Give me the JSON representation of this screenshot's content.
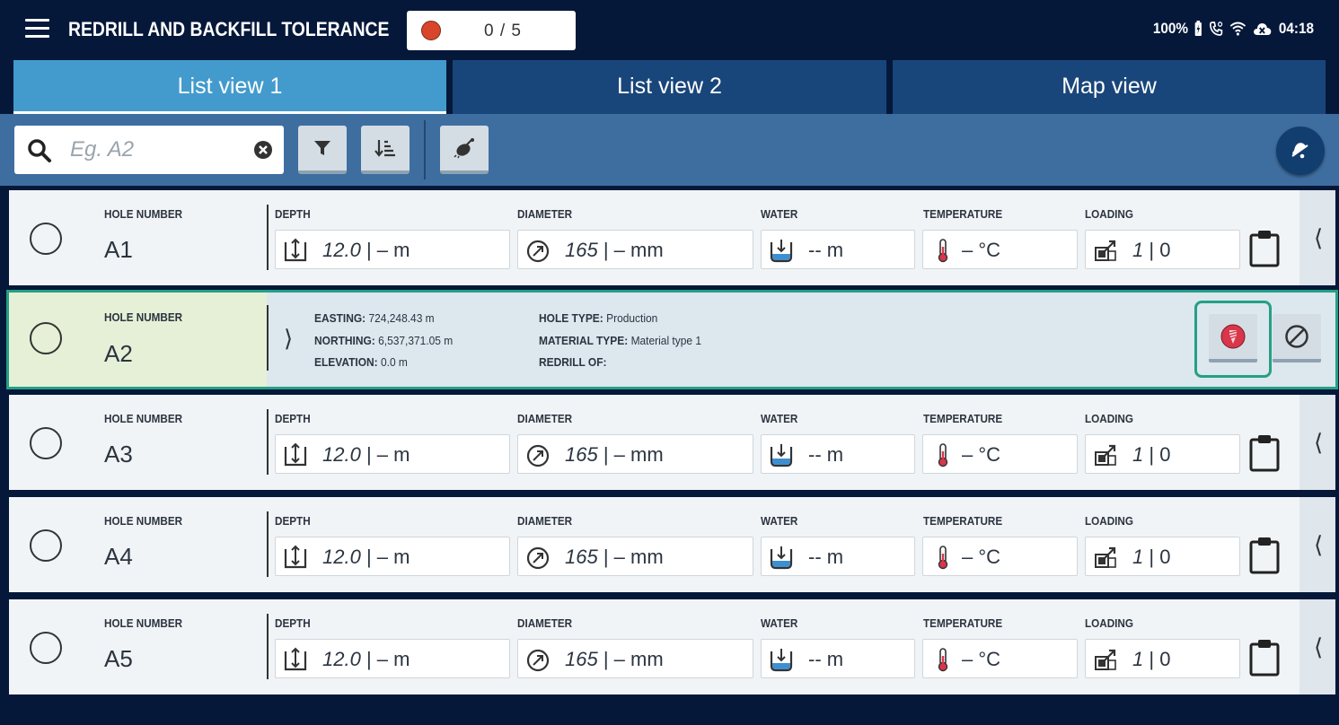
{
  "header": {
    "title": "REDRILL AND BACKFILL TOLERANCE",
    "progress": "0 / 5",
    "status_color": "#d8452b"
  },
  "status_bar": {
    "battery": "100%",
    "time": "04:18",
    "icons": [
      "battery-charging-icon",
      "phone-icon",
      "wifi-icon",
      "cloud-off-icon"
    ]
  },
  "tabs": [
    {
      "label": "List view 1",
      "active": true
    },
    {
      "label": "List view 2",
      "active": false
    },
    {
      "label": "Map view",
      "active": false
    }
  ],
  "toolbar": {
    "search_placeholder": "Eg. A2",
    "buttons": [
      "filter-icon",
      "sort-icon",
      "satellite-icon"
    ],
    "notification": "bell-icon"
  },
  "labels": {
    "hole_number": "HOLE NUMBER",
    "depth": "DEPTH",
    "diameter": "DIAMETER",
    "water": "WATER",
    "temperature": "TEMPERATURE",
    "loading": "LOADING"
  },
  "rows": [
    {
      "hole": "A1",
      "depth_val": "12.0",
      "depth_rest": " |  –  m",
      "diam_val": "165",
      "diam_rest": " |  –  mm",
      "water": "-- m",
      "temp": "– °C",
      "load_val": "1",
      "load_rest": " | 0"
    },
    {
      "hole": "A3",
      "depth_val": "12.0",
      "depth_rest": " |  –  m",
      "diam_val": "165",
      "diam_rest": " |  –  mm",
      "water": "-- m",
      "temp": "– °C",
      "load_val": "1",
      "load_rest": " | 0"
    },
    {
      "hole": "A4",
      "depth_val": "12.0",
      "depth_rest": " |  –  m",
      "diam_val": "165",
      "diam_rest": " |  –  mm",
      "water": "-- m",
      "temp": "– °C",
      "load_val": "1",
      "load_rest": " | 0"
    },
    {
      "hole": "A5",
      "depth_val": "12.0",
      "depth_rest": " |  –  m",
      "diam_val": "165",
      "diam_rest": " |  –  mm",
      "water": "-- m",
      "temp": "– °C",
      "load_val": "1",
      "load_rest": " | 0"
    }
  ],
  "expanded_row": {
    "hole": "A2",
    "easting_label": "EASTING:",
    "easting": "724,248.43 m",
    "northing_label": "NORTHING:",
    "northing": "6,537,371.05 m",
    "elevation_label": "ELEVATION:",
    "elevation": "0.0 m",
    "hole_type_label": "HOLE TYPE:",
    "hole_type": "Production",
    "material_type_label": "MATERIAL TYPE:",
    "material_type": "Material type 1",
    "redrill_of_label": "REDRILL OF:",
    "redrill_of": ""
  }
}
